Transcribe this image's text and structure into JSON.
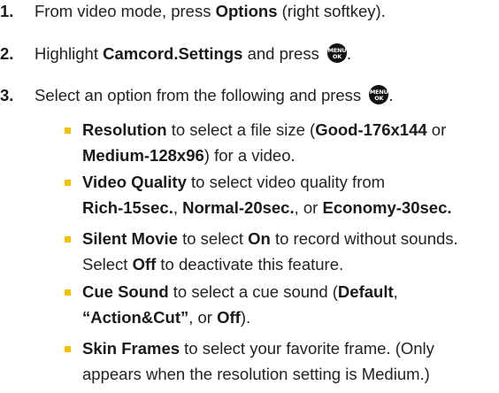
{
  "steps": [
    {
      "num": "1.",
      "pre": "From video mode, press ",
      "bold": "Options",
      "post": " (right softkey)."
    },
    {
      "num": "2.",
      "pre": "Highlight ",
      "bold": "Camcord.Settings",
      "post": " and press ",
      "end": "."
    },
    {
      "num": "3.",
      "pre": "Select an option from the following and press ",
      "end": "."
    }
  ],
  "menu_key": {
    "icon": "menu-ok-key-icon",
    "top": "MENU",
    "bottom": "OK"
  },
  "options": [
    {
      "lines": [
        [
          {
            "t": "Resolution",
            "b": true
          },
          {
            "t": " to select a file size ("
          },
          {
            "t": "Good-176x144",
            "b": true
          },
          {
            "t": " or"
          }
        ],
        [
          {
            "t": "Medium-128x96",
            "b": true
          },
          {
            "t": ") for a video."
          }
        ]
      ]
    },
    {
      "lines": [
        [
          {
            "t": "Video Quality",
            "b": true
          },
          {
            "t": " to select video quality from"
          }
        ],
        [
          {
            "t": "Rich-15sec.",
            "b": true
          },
          {
            "t": ", "
          },
          {
            "t": "Normal-20sec.",
            "b": true
          },
          {
            "t": ", or "
          },
          {
            "t": "Economy-30sec.",
            "b": true
          }
        ]
      ]
    },
    {
      "lines": [
        [
          {
            "t": "Silent Movie",
            "b": true
          },
          {
            "t": " to select "
          },
          {
            "t": "On",
            "b": true
          },
          {
            "t": " to record without sounds."
          }
        ],
        [
          {
            "t": "Select "
          },
          {
            "t": "Off",
            "b": true
          },
          {
            "t": " to deactivate this feature."
          }
        ]
      ]
    },
    {
      "lines": [
        [
          {
            "t": "Cue Sound",
            "b": true
          },
          {
            "t": " to select a cue sound ("
          },
          {
            "t": "Default",
            "b": true
          },
          {
            "t": ","
          }
        ],
        [
          {
            "t": "“Action&Cut”",
            "b": true
          },
          {
            "t": ", or "
          },
          {
            "t": "Off",
            "b": true
          },
          {
            "t": ")."
          }
        ]
      ]
    },
    {
      "lines": [
        [
          {
            "t": "Skin Frames",
            "b": true
          },
          {
            "t": " to select your favorite frame. (Only"
          }
        ],
        [
          {
            "t": "appears when the resolution setting is Medium.)"
          }
        ]
      ]
    }
  ],
  "colors": {
    "bullet": "#f2c200",
    "text": "#222222"
  }
}
